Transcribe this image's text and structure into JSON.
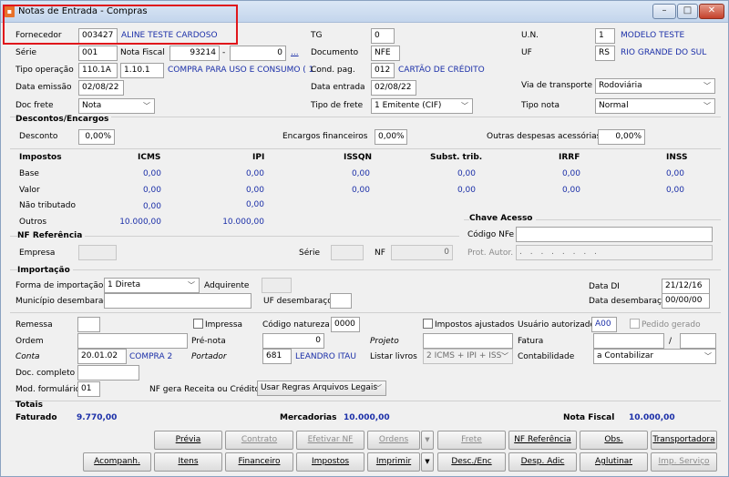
{
  "window": {
    "title": "Notas de Entrada - Compras",
    "icon": "app-icon"
  },
  "header": {
    "fornecedor_label": "Fornecedor",
    "fornecedor_code": "003427",
    "fornecedor_name": "ALINE TESTE CARDOSO",
    "tg_label": "TG",
    "tg_value": "0",
    "un_label": "U.N.",
    "un_code": "1",
    "un_name": "MODELO TESTE",
    "serie_label": "Série",
    "serie_value": "001",
    "nota_label": "Nota Fiscal",
    "nota_value": "93214",
    "nota_dash": "-",
    "nota_suffix": "0",
    "ellipsis": "...",
    "documento_label": "Documento",
    "documento_value": "NFE",
    "uf_label": "UF",
    "uf_code": "RS",
    "uf_name": "RIO GRANDE DO SUL",
    "tipo_op_label": "Tipo operação",
    "tipo_op_code": "110.1A",
    "tipo_op_sub": "1.10.1",
    "tipo_op_desc": "COMPRA PARA USO E CONSUMO ( 1",
    "cond_pag_label": "Cond. pag.",
    "cond_pag_code": "012",
    "cond_pag_desc": "CARTÃO DE CRÉDITO",
    "data_emissao_label": "Data emissão",
    "data_emissao": "02/08/22",
    "data_entrada_label": "Data entrada",
    "data_entrada": "02/08/22",
    "via_label": "Via de transporte",
    "via_value": "Rodoviária",
    "doc_frete_label": "Doc frete",
    "doc_frete_value": "Nota",
    "tipo_frete_label": "Tipo de frete",
    "tipo_frete_value": "1 Emitente (CIF)",
    "tipo_nota_label": "Tipo nota",
    "tipo_nota_value": "Normal"
  },
  "descontos": {
    "title": "Descontos/Encargos",
    "desconto_label": "Desconto",
    "desconto_value": "0,00%",
    "encargos_label": "Encargos financeiros",
    "encargos_value": "0,00%",
    "outras_label": "Outras despesas acessórias",
    "outras_value": "0,00%"
  },
  "impostos": {
    "title": "Impostos",
    "columns": [
      "ICMS",
      "IPI",
      "ISSQN",
      "Subst. trib.",
      "IRRF",
      "INSS"
    ],
    "row_labels": [
      "Base",
      "Valor",
      "Não tributado",
      "Outros"
    ],
    "base": [
      "0,00",
      "0,00",
      "0,00",
      "0,00",
      "0,00",
      "0,00"
    ],
    "valor": [
      "0,00",
      "0,00",
      "0,00",
      "0,00",
      "0,00",
      "0,00"
    ],
    "nao_tributado": [
      "0,00",
      "0,00"
    ],
    "outros": [
      "10.000,00",
      "10.000,00"
    ]
  },
  "chave": {
    "title": "Chave Acesso",
    "codigo_label": "Código NFe",
    "prot_label": "Prot. Autor.",
    "prot_mask": ". . . . . . . ."
  },
  "nf_ref": {
    "title": "NF Referência",
    "empresa_label": "Empresa",
    "serie_label": "Série",
    "nf_label": "NF",
    "nf_value": "0"
  },
  "importacao": {
    "title": "Importação",
    "forma_label": "Forma de importação",
    "forma_value": "1 Direta",
    "adquirente_label": "Adquirente",
    "municipio_label": "Município desembaraço",
    "uf_label": "UF desembaraço",
    "data_di_label": "Data DI",
    "data_di_value": "21/12/16",
    "data_desemb_label": "Data desembaraço",
    "data_desemb_value": "00/00/00"
  },
  "extra": {
    "remessa_label": "Remessa",
    "impressa_label": "Impressa",
    "codigo_natureza_label": "Código natureza",
    "codigo_natureza_value": "0000",
    "impostos_ajustados_label": "Impostos ajustados",
    "usuario_label": "Usuário autorizado",
    "usuario_value": "A00",
    "pedido_gerado_label": "Pedido gerado",
    "ordem_label": "Ordem",
    "pre_nota_label": "Pré-nota",
    "pre_nota_value": "0",
    "projeto_label": "Projeto",
    "fatura_label": "Fatura",
    "fatura_sep": "/",
    "conta_label": "Conta",
    "conta_code": "20.01.02",
    "conta_name": "COMPRA 2",
    "portador_label": "Portador",
    "portador_code": "681",
    "portador_name": "LEANDRO ITAU",
    "listar_livros_label": "Listar livros",
    "listar_livros_value": "2 ICMS + IPI + ISS",
    "contabilidade_label": "Contabilidade",
    "contabilidade_value": "a Contabilizar",
    "doc_completo_label": "Doc. completo",
    "mod_formulario_label": "Mod. formulário",
    "mod_formulario_value": "01",
    "nf_gera_label": "NF gera Receita ou Crédito",
    "nf_gera_value": "Usar Regras Arquivos Legais"
  },
  "totais": {
    "title": "Totais",
    "faturado_label": "Faturado",
    "faturado_value": "9.770,00",
    "mercadorias_label": "Mercadorias",
    "mercadorias_value": "10.000,00",
    "nota_label": "Nota Fiscal",
    "nota_value": "10.000,00"
  },
  "buttons_row1": [
    "Prévia",
    "Contrato",
    "Efetivar NF",
    "Ordens",
    "Frete",
    "NF Referência",
    "Obs.",
    "Transportadora"
  ],
  "buttons_row2": [
    "Acompanh.",
    "Itens",
    "Financeiro",
    "Impostos",
    "Imprimir",
    "Desc./Enc",
    "Desp. Adic",
    "Aglutinar",
    "Imp. Serviço"
  ],
  "colors": {
    "accent_blue": "#1b2fa8",
    "highlight_red": "#e0161b",
    "titlebar": "#c3d5ec"
  }
}
